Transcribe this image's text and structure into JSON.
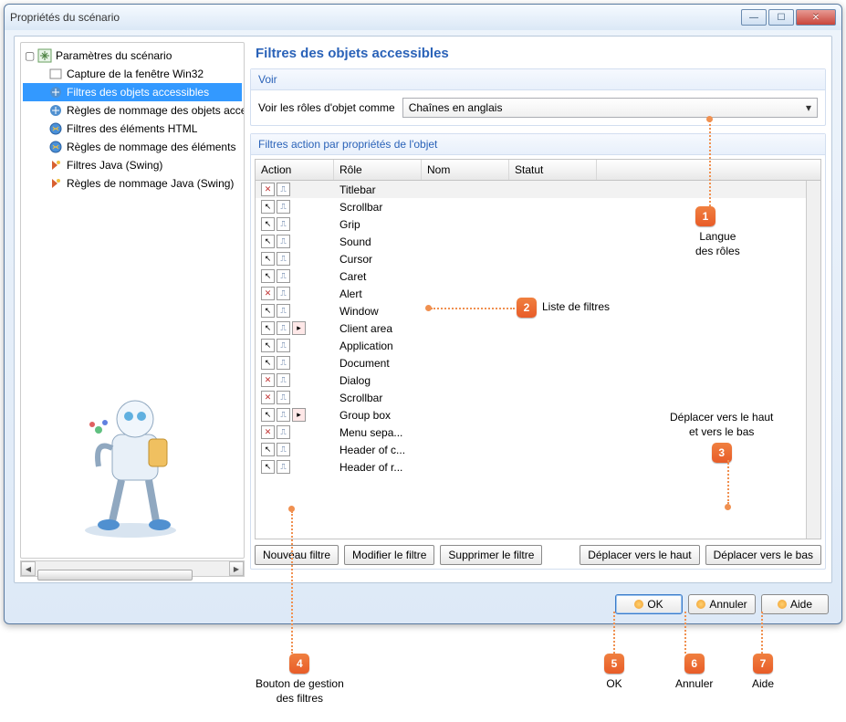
{
  "window": {
    "title": "Propriétés du scénario"
  },
  "tree": {
    "root": "Paramètres du scénario",
    "items": [
      "Capture de la fenêtre Win32",
      "Filtres des objets accessibles",
      "Règles de nommage des objets accessibles",
      "Filtres des éléments HTML",
      "Règles de nommage des éléments",
      "Filtres Java (Swing)",
      "Règles de nommage Java (Swing)"
    ],
    "selected_index": 1
  },
  "right": {
    "title": "Filtres des objets accessibles",
    "voir_group": "Voir",
    "voir_label": "Voir les rôles d'objet comme",
    "voir_value": "Chaînes en anglais",
    "filter_group": "Filtres action par propriétés de l'objet",
    "columns": {
      "action": "Action",
      "role": "Rôle",
      "nom": "Nom",
      "statut": "Statut"
    },
    "rows": [
      {
        "ico": "x",
        "role": "Titlebar"
      },
      {
        "ico": "h",
        "role": "Scrollbar"
      },
      {
        "ico": "h",
        "role": "Grip"
      },
      {
        "ico": "h",
        "role": "Sound"
      },
      {
        "ico": "h",
        "role": "Cursor"
      },
      {
        "ico": "h",
        "role": "Caret"
      },
      {
        "ico": "x",
        "role": "Alert"
      },
      {
        "ico": "h",
        "role": "Window"
      },
      {
        "ico": "r",
        "role": "Client area"
      },
      {
        "ico": "h",
        "role": "Application"
      },
      {
        "ico": "h",
        "role": "Document"
      },
      {
        "ico": "x",
        "role": "Dialog"
      },
      {
        "ico": "x",
        "role": "Scrollbar"
      },
      {
        "ico": "r",
        "role": "Group box"
      },
      {
        "ico": "x",
        "role": "Menu sepa..."
      },
      {
        "ico": "h",
        "role": "Header of c..."
      },
      {
        "ico": "h",
        "role": "Header of r..."
      }
    ],
    "buttons": {
      "new": "Nouveau filtre",
      "edit": "Modifier le filtre",
      "del": "Supprimer le filtre",
      "up": "Déplacer vers le haut",
      "down": "Déplacer vers le bas"
    }
  },
  "footer": {
    "ok": "OK",
    "cancel": "Annuler",
    "help": "Aide"
  },
  "annotations": {
    "a1": {
      "num": "1",
      "label": "Langue\ndes rôles"
    },
    "a2": {
      "num": "2",
      "label": "Liste de filtres"
    },
    "a3": {
      "num": "3",
      "label": "Déplacer vers le haut\net vers le bas"
    },
    "a4": {
      "num": "4",
      "label": "Bouton de gestion\ndes filtres"
    },
    "a5": {
      "num": "5",
      "label": "OK"
    },
    "a6": {
      "num": "6",
      "label": "Annuler"
    },
    "a7": {
      "num": "7",
      "label": "Aide"
    }
  }
}
